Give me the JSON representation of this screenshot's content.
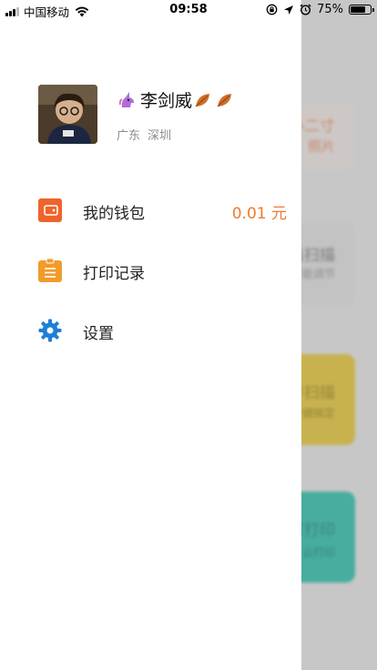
{
  "status_bar": {
    "carrier": "中国移动",
    "time": "09:58",
    "battery_percent_text": "75%",
    "battery_level": 0.75
  },
  "background_app": {
    "card_1": {
      "line1": "小二寸",
      "line2": "照片"
    },
    "card_2": {
      "title": "当扫描",
      "subtitle": "智能调节"
    },
    "card_3": {
      "title": "件扫描",
      "subtitle": "一键搞定"
    },
    "card_4": {
      "title": "可打印",
      "subtitle": "云打印"
    }
  },
  "profile": {
    "name": "李剑威",
    "region_province": "广东",
    "region_city": "深圳"
  },
  "menu": {
    "wallet": {
      "label": "我的钱包",
      "value": "0.01 元",
      "icon": "wallet-icon",
      "color": "#f0632c"
    },
    "print_history": {
      "label": "打印记录",
      "icon": "clipboard-icon",
      "color": "#f29b2a"
    },
    "settings": {
      "label": "设置",
      "icon": "gear-icon",
      "color": "#1f7fd6"
    }
  }
}
